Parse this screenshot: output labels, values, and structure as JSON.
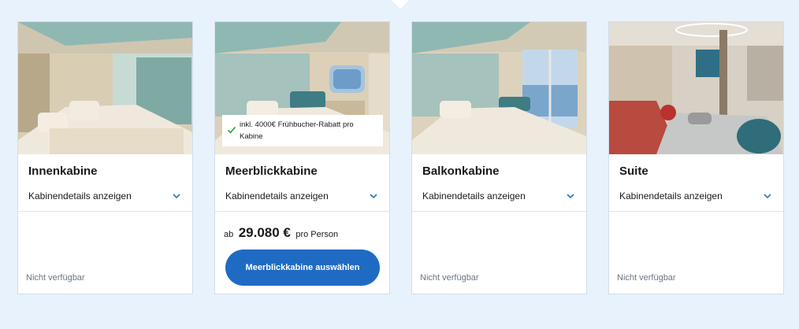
{
  "cabins": [
    {
      "name": "Innenkabine",
      "details_label": "Kabinendetails anzeigen",
      "availability": "Nicht verfügbar"
    },
    {
      "name": "Meerblickkabine",
      "details_label": "Kabinendetails anzeigen",
      "badge": "inkl. 4000€ Frühbucher-Rabatt pro Kabine",
      "price": {
        "prefix": "ab",
        "amount": "29.080 €",
        "suffix": "pro Person"
      },
      "select_button": "Meerblickkabine auswählen"
    },
    {
      "name": "Balkonkabine",
      "details_label": "Kabinendetails anzeigen",
      "availability": "Nicht verfügbar"
    },
    {
      "name": "Suite",
      "details_label": "Kabinendetails anzeigen",
      "availability": "Nicht verfügbar"
    }
  ],
  "icons": {
    "expand": "chevron-down-icon",
    "badge": "checkmark-icon"
  },
  "colors": {
    "accent": "#1f6bc4",
    "check": "#2e9e3e",
    "chevron": "#2a7ab8",
    "background": "#e8f2fc"
  }
}
